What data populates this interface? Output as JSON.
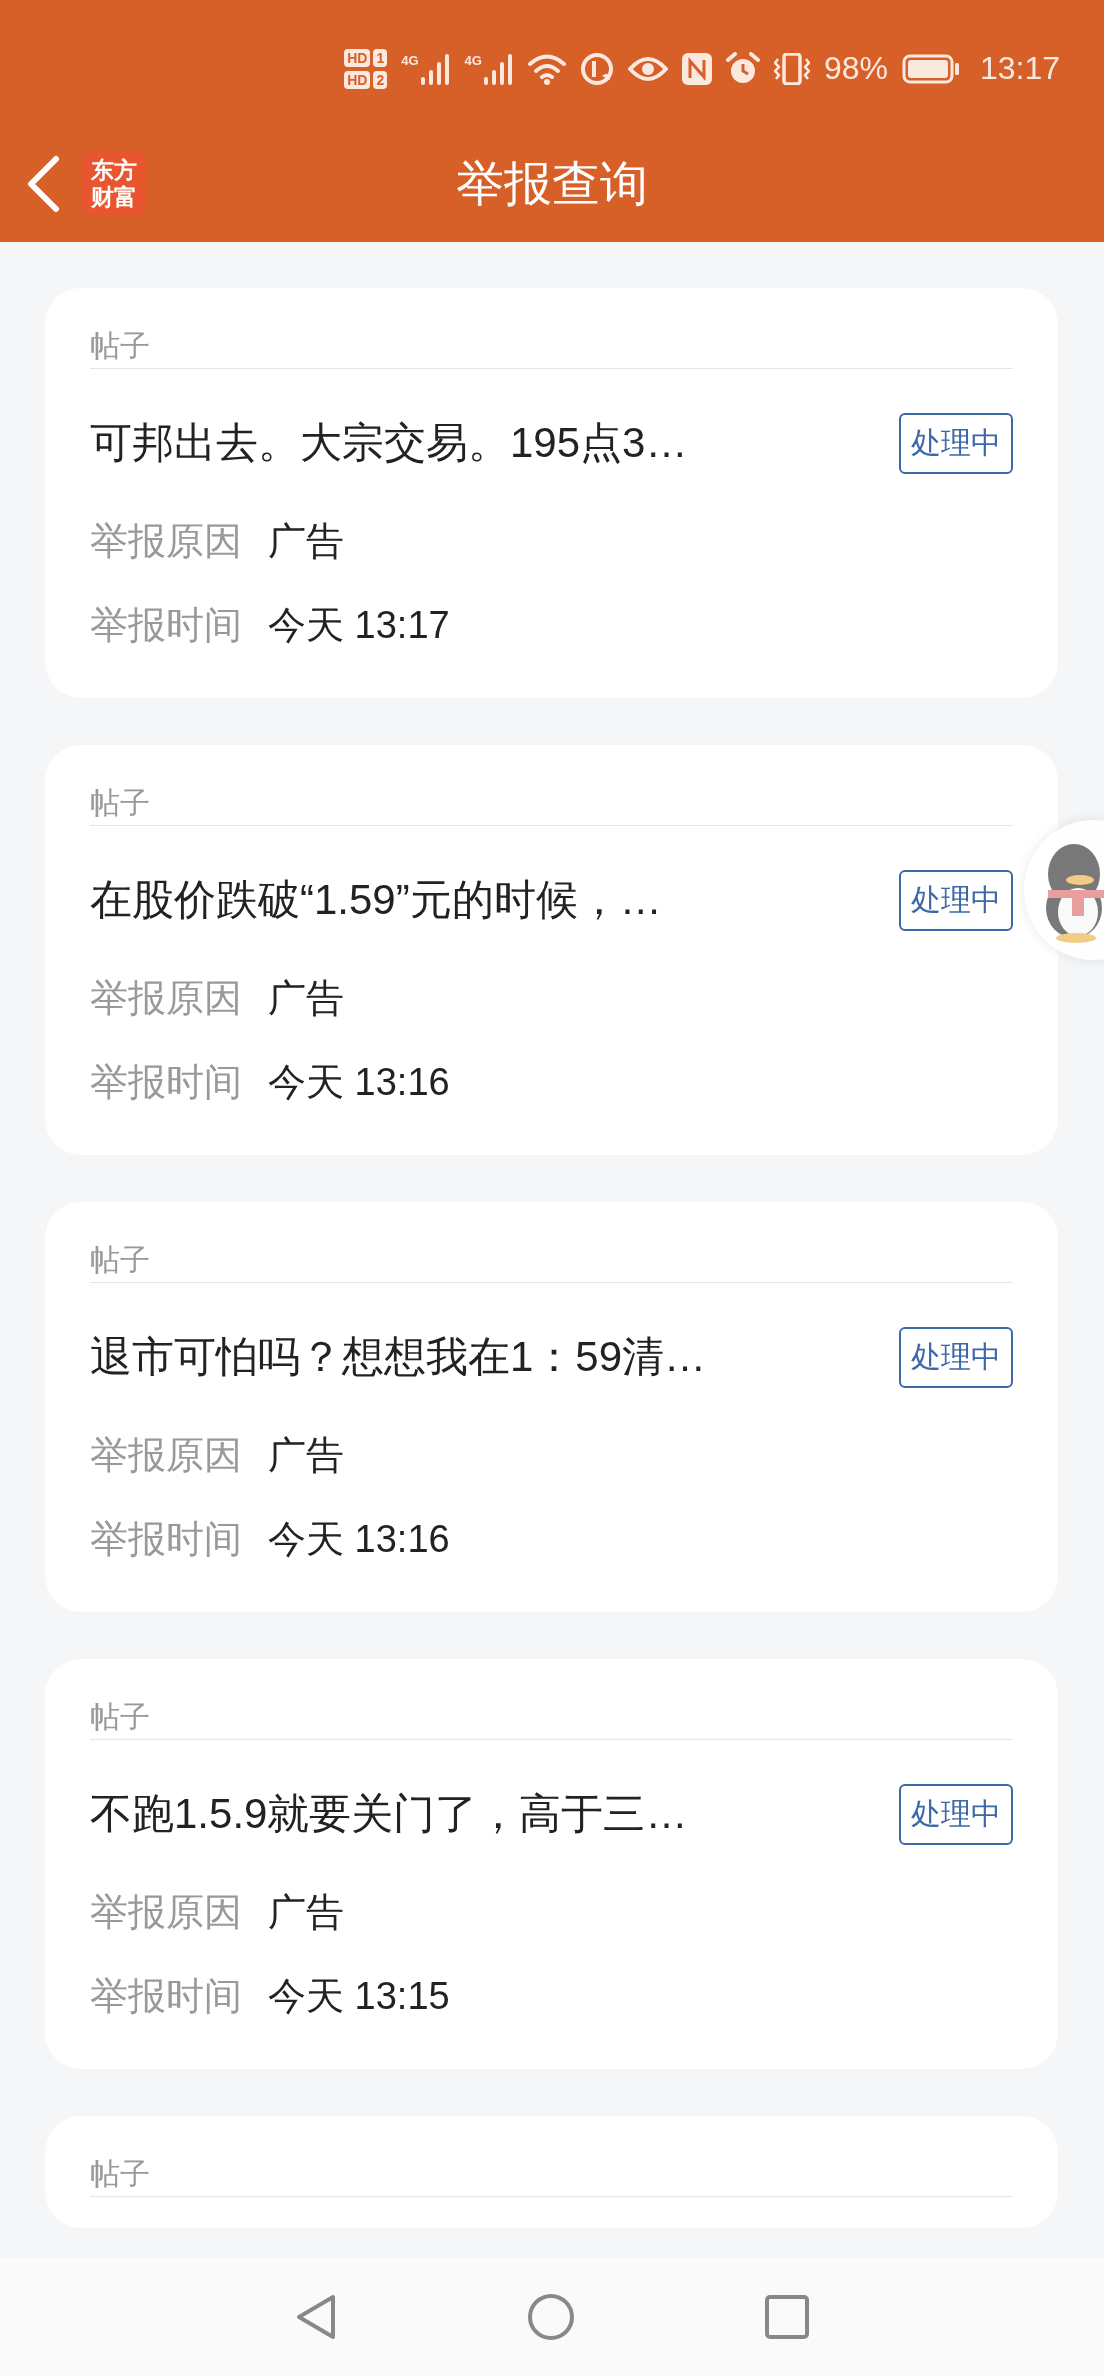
{
  "status_bar": {
    "sim_labels": [
      {
        "network": "HD",
        "slot": "1"
      },
      {
        "network": "HD",
        "slot": "2"
      }
    ],
    "signals": [
      "4G",
      "4G"
    ],
    "battery": "98%",
    "time": "13:17"
  },
  "header": {
    "logo": "东方财富",
    "title": "举报查询"
  },
  "reports": [
    {
      "type": "帖子",
      "title": "可邦出去。大宗交易。195点3…",
      "status": "处理中",
      "reason_label": "举报原因",
      "reason": "广告",
      "time_label": "举报时间",
      "time": "今天 13:17"
    },
    {
      "type": "帖子",
      "title": "在股价跌破“1.59”元的时候，…",
      "status": "处理中",
      "reason_label": "举报原因",
      "reason": "广告",
      "time_label": "举报时间",
      "time": "今天 13:16"
    },
    {
      "type": "帖子",
      "title": "退市可怕吗？想想我在1：59清…",
      "status": "处理中",
      "reason_label": "举报原因",
      "reason": "广告",
      "time_label": "举报时间",
      "time": "今天 13:16"
    },
    {
      "type": "帖子",
      "title": "不跑1.5.9就要关门了，高于三…",
      "status": "处理中",
      "reason_label": "举报原因",
      "reason": "广告",
      "time_label": "举报时间",
      "time": "今天 13:15"
    },
    {
      "type": "帖子"
    }
  ]
}
